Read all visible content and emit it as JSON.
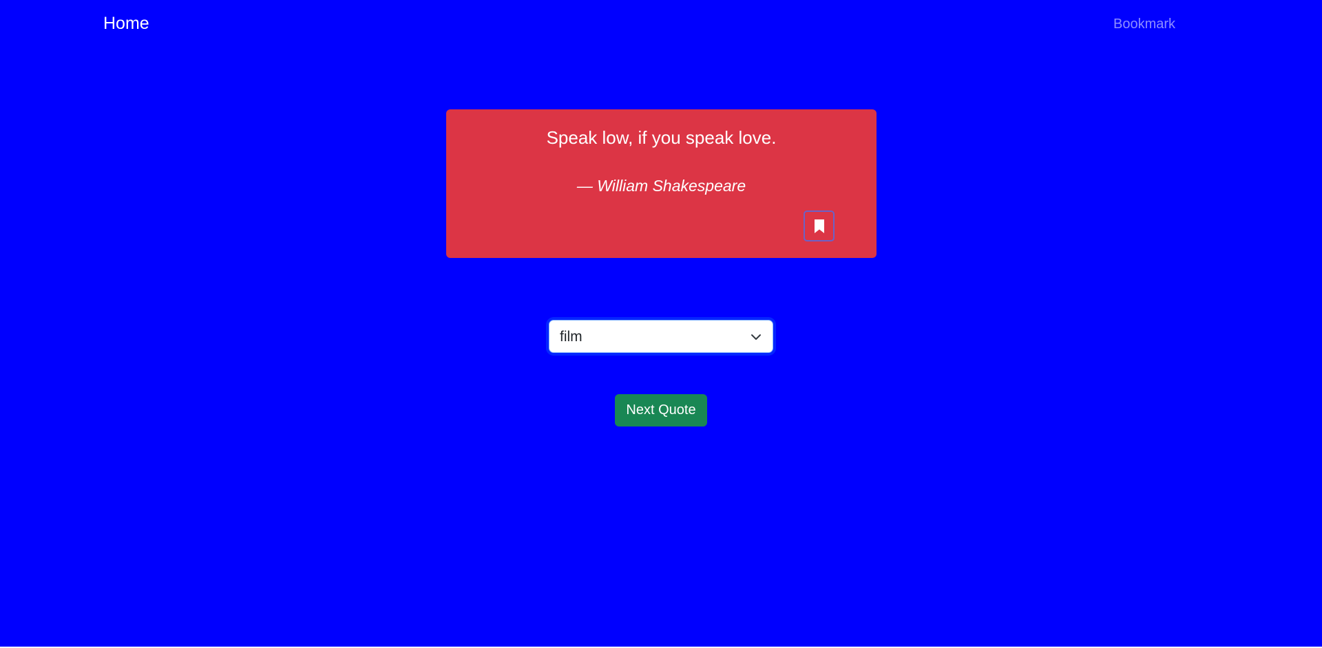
{
  "nav": {
    "home_label": "Home",
    "bookmark_label": "Bookmark"
  },
  "quote": {
    "text": "Speak low, if you speak love.",
    "author": "— William Shakespeare",
    "bookmark_icon": "bookmark-icon"
  },
  "category_select": {
    "selected": "film",
    "icon": "chevron-down-icon"
  },
  "next_button": {
    "label": "Next Quote"
  },
  "colors": {
    "page_background": "#0000ff",
    "card_background": "#dc3545",
    "next_button": "#198754",
    "text": "#ffffff"
  }
}
